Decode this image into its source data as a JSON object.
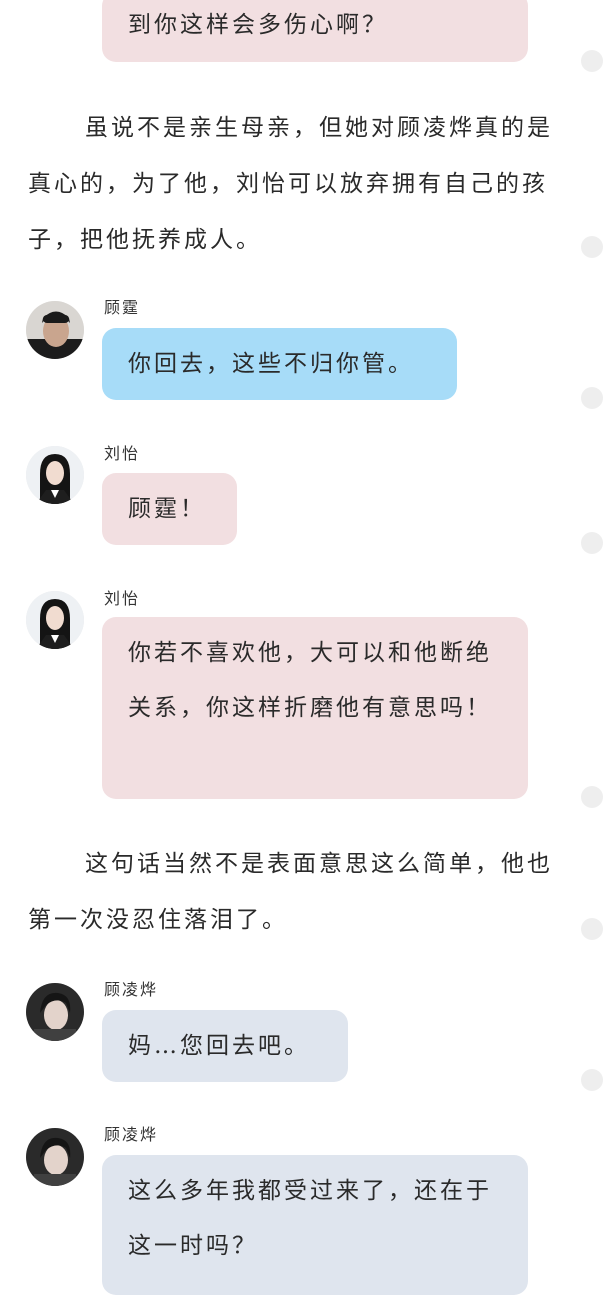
{
  "messages": {
    "m0": {
      "text": "到你这样会多伤心啊？"
    },
    "m1": {
      "name": "顾霆",
      "text": "你回去，这些不归你管。"
    },
    "m2": {
      "name": "刘怡",
      "text": "顾霆！"
    },
    "m3": {
      "name": "刘怡",
      "text": "你若不喜欢他，大可以和他断绝关系，你这样折磨他有意思吗！"
    },
    "m4": {
      "name": "顾凌烨",
      "text": "妈…您回去吧。"
    },
    "m5": {
      "name": "顾凌烨",
      "text": "这么多年我都受过来了，还在于这一时吗？"
    }
  },
  "narration": {
    "p1": "虽说不是亲生母亲，但她对顾凌烨真的是真心的，为了他，刘怡可以放弃拥有自己的孩子，把他抚养成人。",
    "p2": "这句话当然不是表面意思这么简单，他也第一次没忍住落泪了。"
  },
  "colors": {
    "pink_bubble": "#f2dfe1",
    "blue_bubble": "#a7dcf8",
    "grey_bubble": "#dfe5ee"
  }
}
